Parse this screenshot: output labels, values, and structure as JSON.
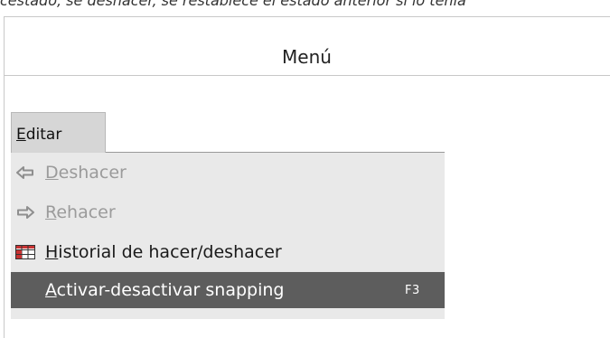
{
  "top_fragment": "cestado, se deshacer, se restablece el estado anterior si lo tenía",
  "header": {
    "title": "Menú"
  },
  "menu": {
    "title_mnemonic": "E",
    "title_rest": "ditar",
    "items": [
      {
        "mnemonic": "D",
        "rest": "eshacer",
        "icon": "undo-arrow-icon",
        "state": "disabled",
        "shortcut": ""
      },
      {
        "mnemonic": "R",
        "rest": "ehacer",
        "icon": "redo-arrow-icon",
        "state": "disabled",
        "shortcut": ""
      },
      {
        "mnemonic": "H",
        "rest": "istorial de hacer/deshacer",
        "icon": "history-table-icon",
        "state": "normal",
        "shortcut": ""
      },
      {
        "mnemonic": "A",
        "rest": "ctivar-desactivar snapping",
        "icon": "",
        "state": "active",
        "shortcut": "F3"
      }
    ]
  },
  "colors": {
    "menu_title_bg": "#d6d6d6",
    "dropdown_bg": "#e9e9e9",
    "active_bg": "#5d5d5d",
    "disabled_text": "#9b9b9b",
    "history_icon_red": "#c83232"
  }
}
